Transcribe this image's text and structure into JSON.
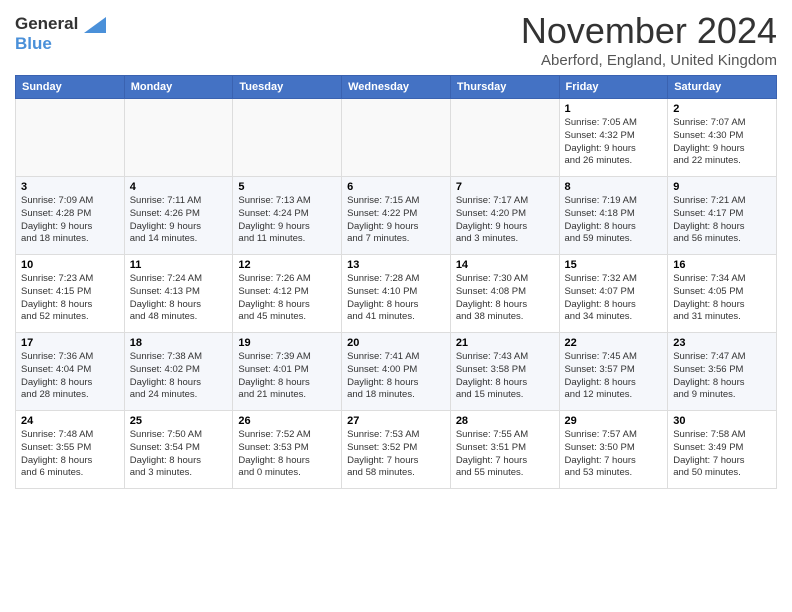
{
  "logo": {
    "line1": "General",
    "line2": "Blue",
    "arrow_color": "#4a90d9"
  },
  "title": "November 2024",
  "location": "Aberford, England, United Kingdom",
  "days_of_week": [
    "Sunday",
    "Monday",
    "Tuesday",
    "Wednesday",
    "Thursday",
    "Friday",
    "Saturday"
  ],
  "weeks": [
    [
      {
        "day": "",
        "info": ""
      },
      {
        "day": "",
        "info": ""
      },
      {
        "day": "",
        "info": ""
      },
      {
        "day": "",
        "info": ""
      },
      {
        "day": "",
        "info": ""
      },
      {
        "day": "1",
        "info": "Sunrise: 7:05 AM\nSunset: 4:32 PM\nDaylight: 9 hours\nand 26 minutes."
      },
      {
        "day": "2",
        "info": "Sunrise: 7:07 AM\nSunset: 4:30 PM\nDaylight: 9 hours\nand 22 minutes."
      }
    ],
    [
      {
        "day": "3",
        "info": "Sunrise: 7:09 AM\nSunset: 4:28 PM\nDaylight: 9 hours\nand 18 minutes."
      },
      {
        "day": "4",
        "info": "Sunrise: 7:11 AM\nSunset: 4:26 PM\nDaylight: 9 hours\nand 14 minutes."
      },
      {
        "day": "5",
        "info": "Sunrise: 7:13 AM\nSunset: 4:24 PM\nDaylight: 9 hours\nand 11 minutes."
      },
      {
        "day": "6",
        "info": "Sunrise: 7:15 AM\nSunset: 4:22 PM\nDaylight: 9 hours\nand 7 minutes."
      },
      {
        "day": "7",
        "info": "Sunrise: 7:17 AM\nSunset: 4:20 PM\nDaylight: 9 hours\nand 3 minutes."
      },
      {
        "day": "8",
        "info": "Sunrise: 7:19 AM\nSunset: 4:18 PM\nDaylight: 8 hours\nand 59 minutes."
      },
      {
        "day": "9",
        "info": "Sunrise: 7:21 AM\nSunset: 4:17 PM\nDaylight: 8 hours\nand 56 minutes."
      }
    ],
    [
      {
        "day": "10",
        "info": "Sunrise: 7:23 AM\nSunset: 4:15 PM\nDaylight: 8 hours\nand 52 minutes."
      },
      {
        "day": "11",
        "info": "Sunrise: 7:24 AM\nSunset: 4:13 PM\nDaylight: 8 hours\nand 48 minutes."
      },
      {
        "day": "12",
        "info": "Sunrise: 7:26 AM\nSunset: 4:12 PM\nDaylight: 8 hours\nand 45 minutes."
      },
      {
        "day": "13",
        "info": "Sunrise: 7:28 AM\nSunset: 4:10 PM\nDaylight: 8 hours\nand 41 minutes."
      },
      {
        "day": "14",
        "info": "Sunrise: 7:30 AM\nSunset: 4:08 PM\nDaylight: 8 hours\nand 38 minutes."
      },
      {
        "day": "15",
        "info": "Sunrise: 7:32 AM\nSunset: 4:07 PM\nDaylight: 8 hours\nand 34 minutes."
      },
      {
        "day": "16",
        "info": "Sunrise: 7:34 AM\nSunset: 4:05 PM\nDaylight: 8 hours\nand 31 minutes."
      }
    ],
    [
      {
        "day": "17",
        "info": "Sunrise: 7:36 AM\nSunset: 4:04 PM\nDaylight: 8 hours\nand 28 minutes."
      },
      {
        "day": "18",
        "info": "Sunrise: 7:38 AM\nSunset: 4:02 PM\nDaylight: 8 hours\nand 24 minutes."
      },
      {
        "day": "19",
        "info": "Sunrise: 7:39 AM\nSunset: 4:01 PM\nDaylight: 8 hours\nand 21 minutes."
      },
      {
        "day": "20",
        "info": "Sunrise: 7:41 AM\nSunset: 4:00 PM\nDaylight: 8 hours\nand 18 minutes."
      },
      {
        "day": "21",
        "info": "Sunrise: 7:43 AM\nSunset: 3:58 PM\nDaylight: 8 hours\nand 15 minutes."
      },
      {
        "day": "22",
        "info": "Sunrise: 7:45 AM\nSunset: 3:57 PM\nDaylight: 8 hours\nand 12 minutes."
      },
      {
        "day": "23",
        "info": "Sunrise: 7:47 AM\nSunset: 3:56 PM\nDaylight: 8 hours\nand 9 minutes."
      }
    ],
    [
      {
        "day": "24",
        "info": "Sunrise: 7:48 AM\nSunset: 3:55 PM\nDaylight: 8 hours\nand 6 minutes."
      },
      {
        "day": "25",
        "info": "Sunrise: 7:50 AM\nSunset: 3:54 PM\nDaylight: 8 hours\nand 3 minutes."
      },
      {
        "day": "26",
        "info": "Sunrise: 7:52 AM\nSunset: 3:53 PM\nDaylight: 8 hours\nand 0 minutes."
      },
      {
        "day": "27",
        "info": "Sunrise: 7:53 AM\nSunset: 3:52 PM\nDaylight: 7 hours\nand 58 minutes."
      },
      {
        "day": "28",
        "info": "Sunrise: 7:55 AM\nSunset: 3:51 PM\nDaylight: 7 hours\nand 55 minutes."
      },
      {
        "day": "29",
        "info": "Sunrise: 7:57 AM\nSunset: 3:50 PM\nDaylight: 7 hours\nand 53 minutes."
      },
      {
        "day": "30",
        "info": "Sunrise: 7:58 AM\nSunset: 3:49 PM\nDaylight: 7 hours\nand 50 minutes."
      }
    ]
  ]
}
